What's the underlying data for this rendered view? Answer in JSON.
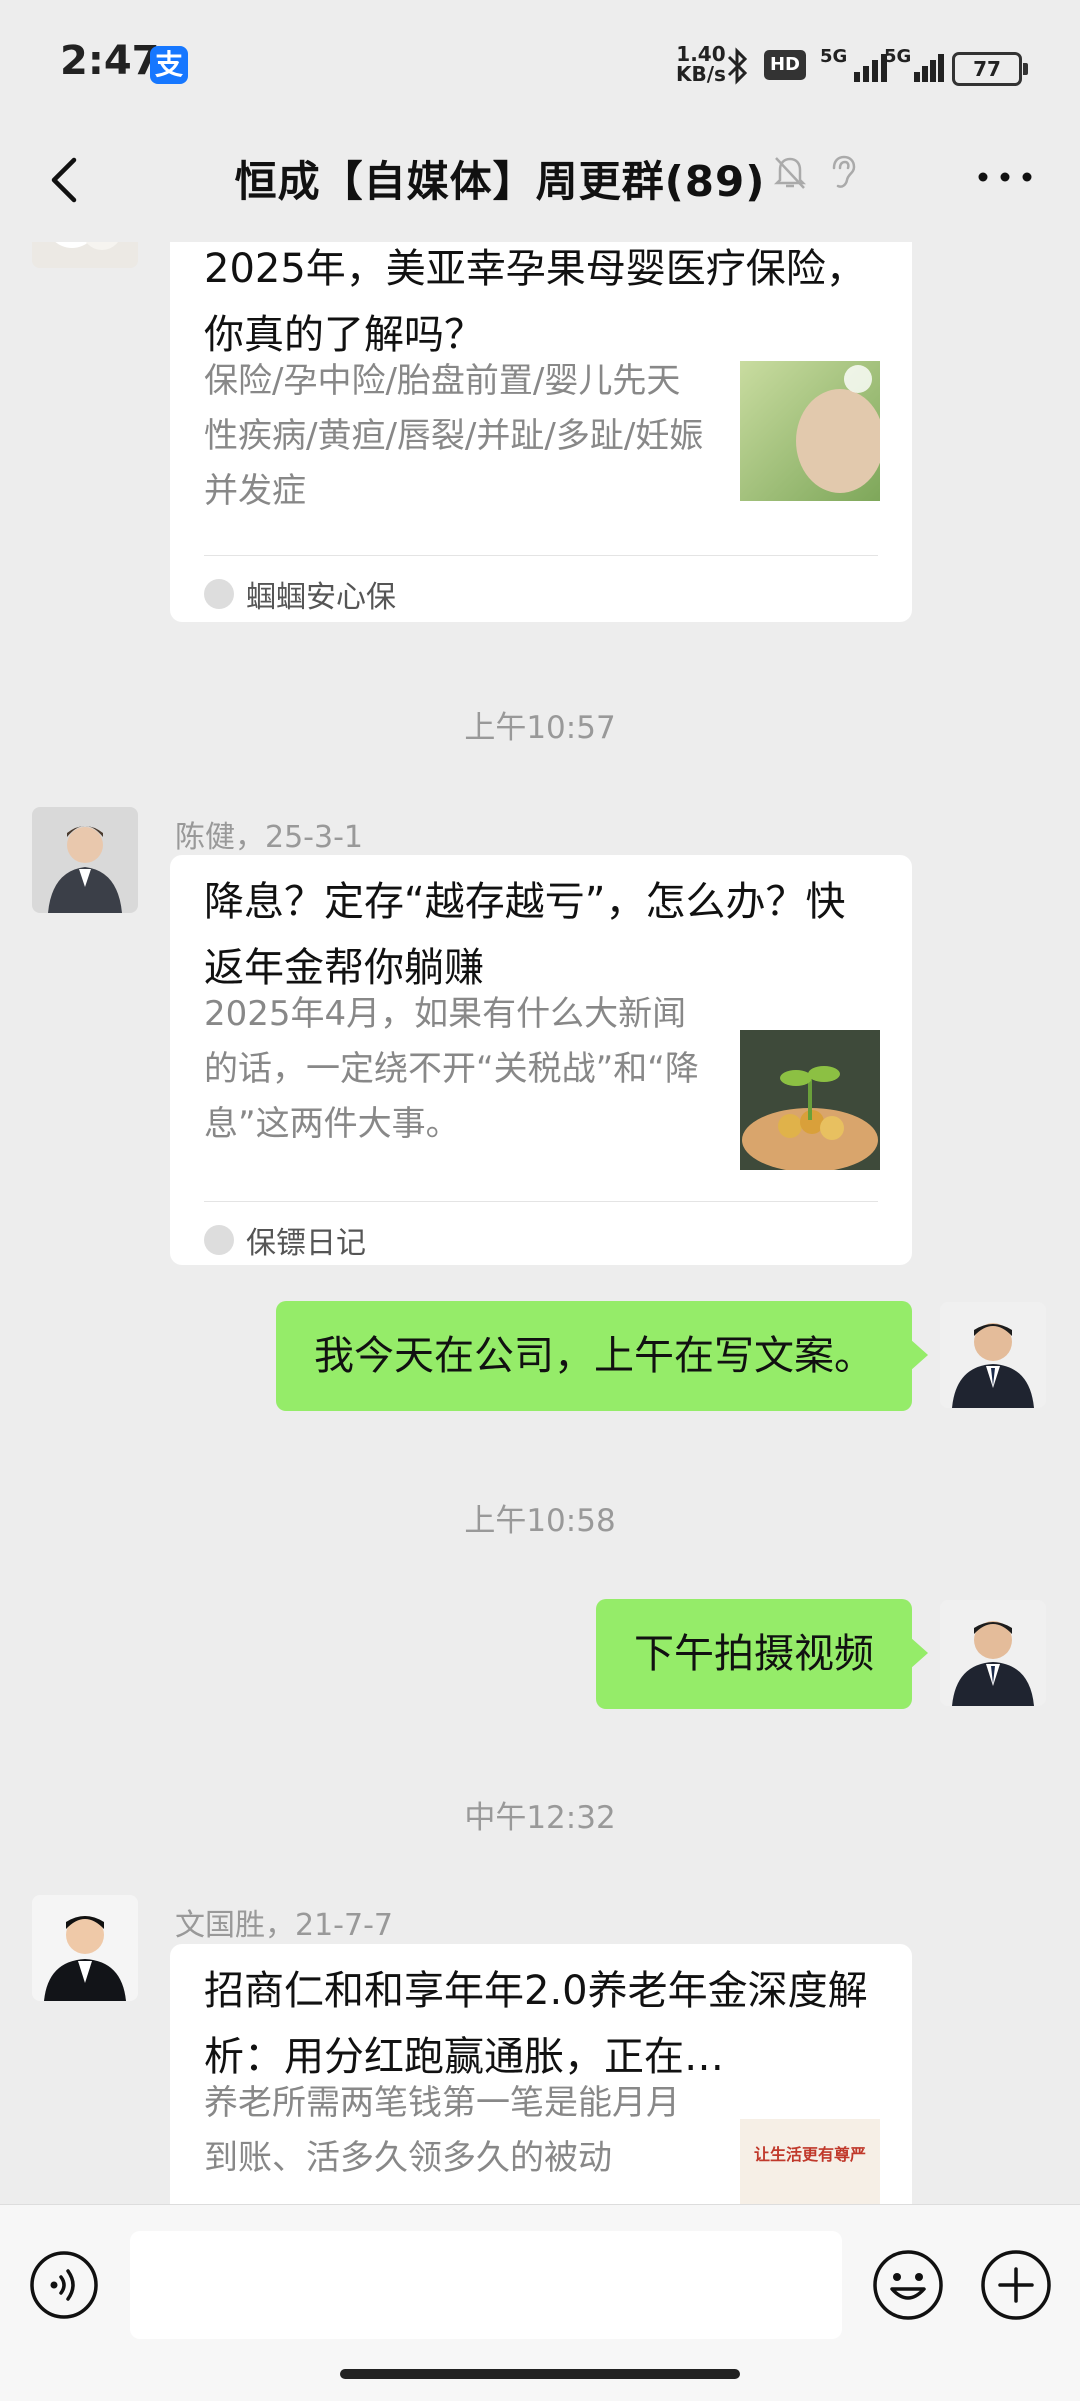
{
  "status": {
    "time": "2:47",
    "alipay_icon": "支",
    "net_speed_value": "1.40",
    "net_speed_unit": "KB/s",
    "hd_badge": "HD",
    "signal1_label": "5G",
    "signal2_label": "5G",
    "battery": "77"
  },
  "chat": {
    "title": "恒成【自媒体】周更群(89)"
  },
  "messages": {
    "card1": {
      "title": "2025年，美亚幸孕果母婴医疗保险，你真的了解吗？",
      "desc": "保险/孕中险/胎盘前置/婴儿先天性疾病/黄疸/唇裂/并趾/多趾/妊娠并发症",
      "source": "蝈蝈安心保"
    },
    "ts1": "上午10:57",
    "sender2": "陈健，25-3-1",
    "card2": {
      "title": "降息？定存“越存越亏”，怎么办？快返年金帮你躺赚",
      "desc": "2025年4月，如果有什么大新闻的话，一定绕不开“关税战”和“降息”这两件大事。",
      "source": "保镖日记"
    },
    "me1": "我今天在公司，上午在写文案。",
    "ts2": "上午10:58",
    "me2": "下午拍摄视频",
    "ts3": "中午12:32",
    "sender3": "文国胜，21-7-7",
    "card3": {
      "title": "招商仁和和享年年2.0养老年金深度解析：用分红跑赢通胀，正在…",
      "desc": "养老所需两笔钱第一笔是能月月到账、活多久领多久的被动",
      "thumb_text": "让生活更有尊严"
    }
  },
  "icons": {
    "back": "chevron-left-icon",
    "mute": "bell-off-icon",
    "ear": "ear-icon",
    "more": "more-dots-icon",
    "voice": "voice-icon",
    "emoji": "emoji-icon",
    "plus": "plus-icon"
  },
  "colors": {
    "bg": "#ededed",
    "bubble_me": "#95ec69",
    "card": "#ffffff"
  }
}
